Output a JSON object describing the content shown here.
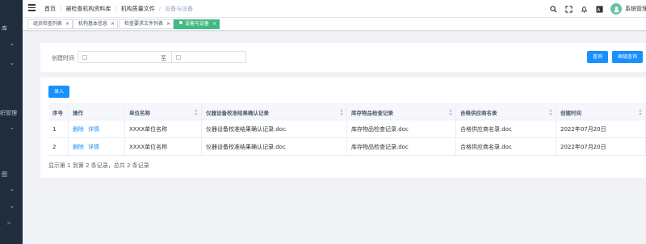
{
  "sidebar": {
    "fragments": [
      "库",
      "织管理",
      "图"
    ]
  },
  "header": {
    "breadcrumb": [
      "首页",
      "被检查机构资料库",
      "机构质量文件",
      "设备与设备"
    ],
    "username": "系统管理员"
  },
  "tags": [
    {
      "label": "组员检查列表",
      "active": false
    },
    {
      "label": "机构基本信息",
      "active": false
    },
    {
      "label": "检查要求文件列表",
      "active": false
    },
    {
      "label": "设备与设备",
      "active": true
    }
  ],
  "search": {
    "created_label": "创建时间",
    "to_label": "至",
    "start_value": "",
    "end_value": "",
    "query_btn": "查询",
    "advanced_btn": "高级查询"
  },
  "toolbar": {
    "add_btn": "录入"
  },
  "table": {
    "columns": [
      "序号",
      "操作",
      "单位名称",
      "仪器设备校准结果确认记录",
      "库存物品检查记录",
      "合格供应商名录",
      "创建时间"
    ],
    "rows": [
      {
        "index": "1",
        "delete": "删除",
        "detail": "详情",
        "unit": "XXXX单位名称",
        "calib": "仪器设备校准结果确认记录.doc",
        "stock": "库存物品检查记录.doc",
        "supplier": "合格供应商名录.doc",
        "created": "2022年07月20日"
      },
      {
        "index": "2",
        "delete": "删除",
        "detail": "详情",
        "unit": "XXXX单位名称",
        "calib": "仪器设备校准结果确认记录.doc",
        "stock": "库存物品检查记录.doc",
        "supplier": "合格供应商名录.doc",
        "created": "2022年07月20日"
      }
    ]
  },
  "pagination": {
    "summary": "显示第 1 到第 2 条记录，总共 2 条记录"
  }
}
